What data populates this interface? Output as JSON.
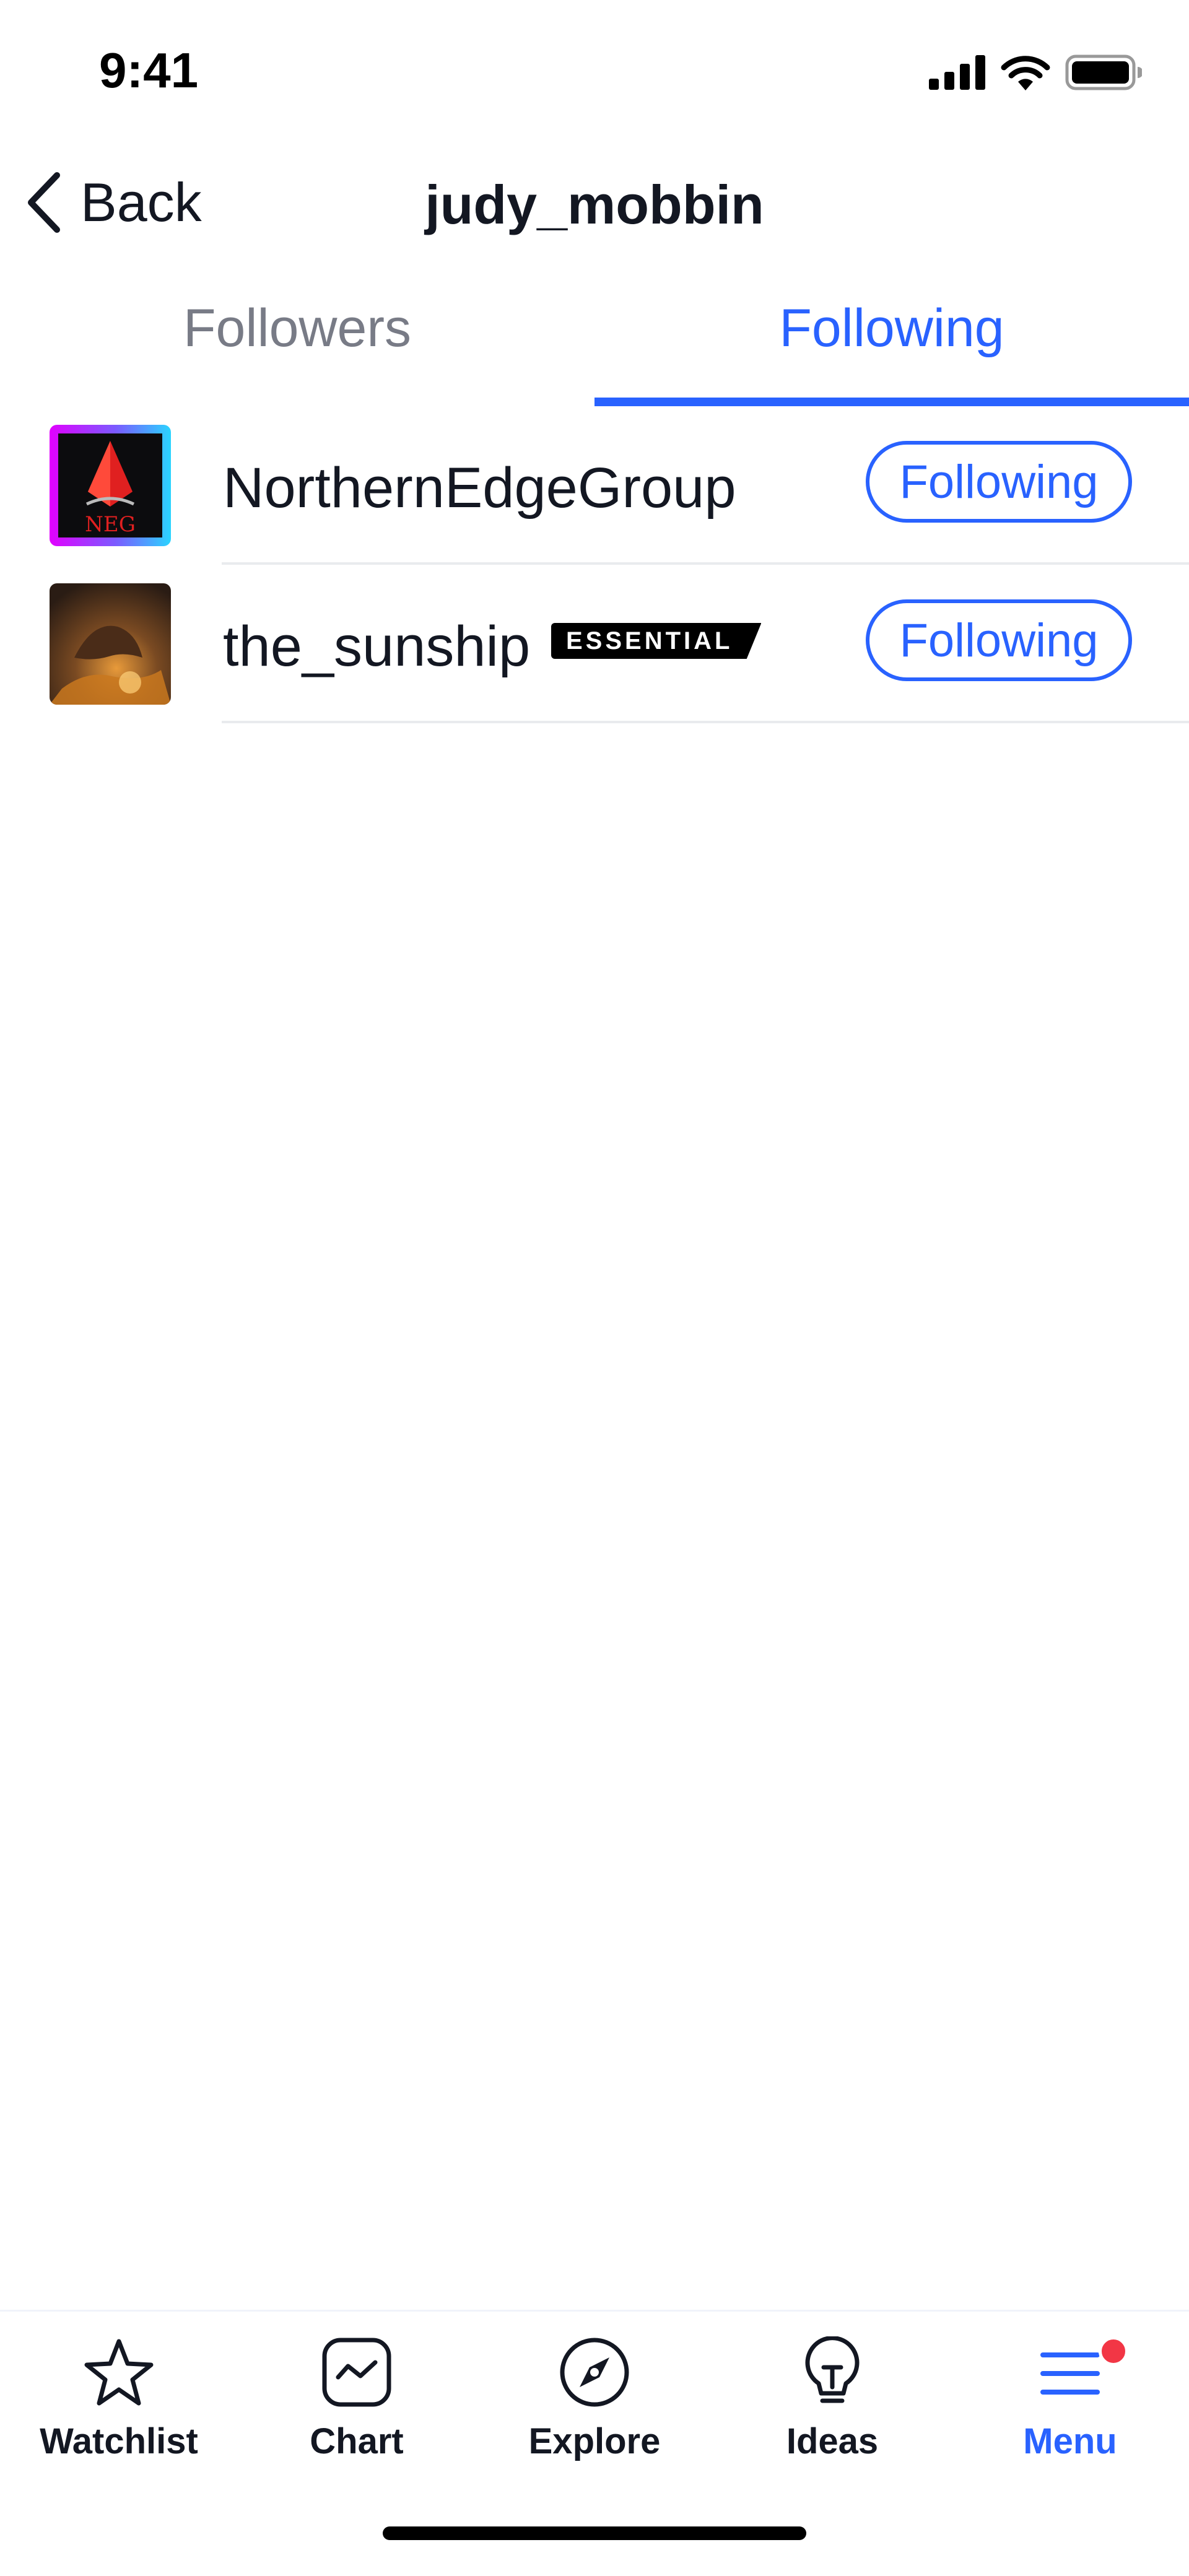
{
  "status": {
    "time": "9:41"
  },
  "nav": {
    "back_label": "Back",
    "title": "judy_mobbin"
  },
  "tabs": [
    {
      "label": "Followers",
      "active": false
    },
    {
      "label": "Following",
      "active": true
    }
  ],
  "users": [
    {
      "name": "NorthernEdgeGroup",
      "avatar_text": "NEG",
      "badge": "",
      "button_label": "Following"
    },
    {
      "name": "the_sunship",
      "badge": "ESSENTIAL",
      "button_label": "Following"
    }
  ],
  "bottom_nav": [
    {
      "label": "Watchlist",
      "icon": "star-icon",
      "active": false
    },
    {
      "label": "Chart",
      "icon": "chart-icon",
      "active": false
    },
    {
      "label": "Explore",
      "icon": "compass-icon",
      "active": false
    },
    {
      "label": "Ideas",
      "icon": "lightbulb-icon",
      "active": false
    },
    {
      "label": "Menu",
      "icon": "menu-icon",
      "active": true,
      "notification": true
    }
  ],
  "colors": {
    "accent": "#2962ff",
    "text": "#131722",
    "muted": "#787b86",
    "notification": "#f23645"
  }
}
